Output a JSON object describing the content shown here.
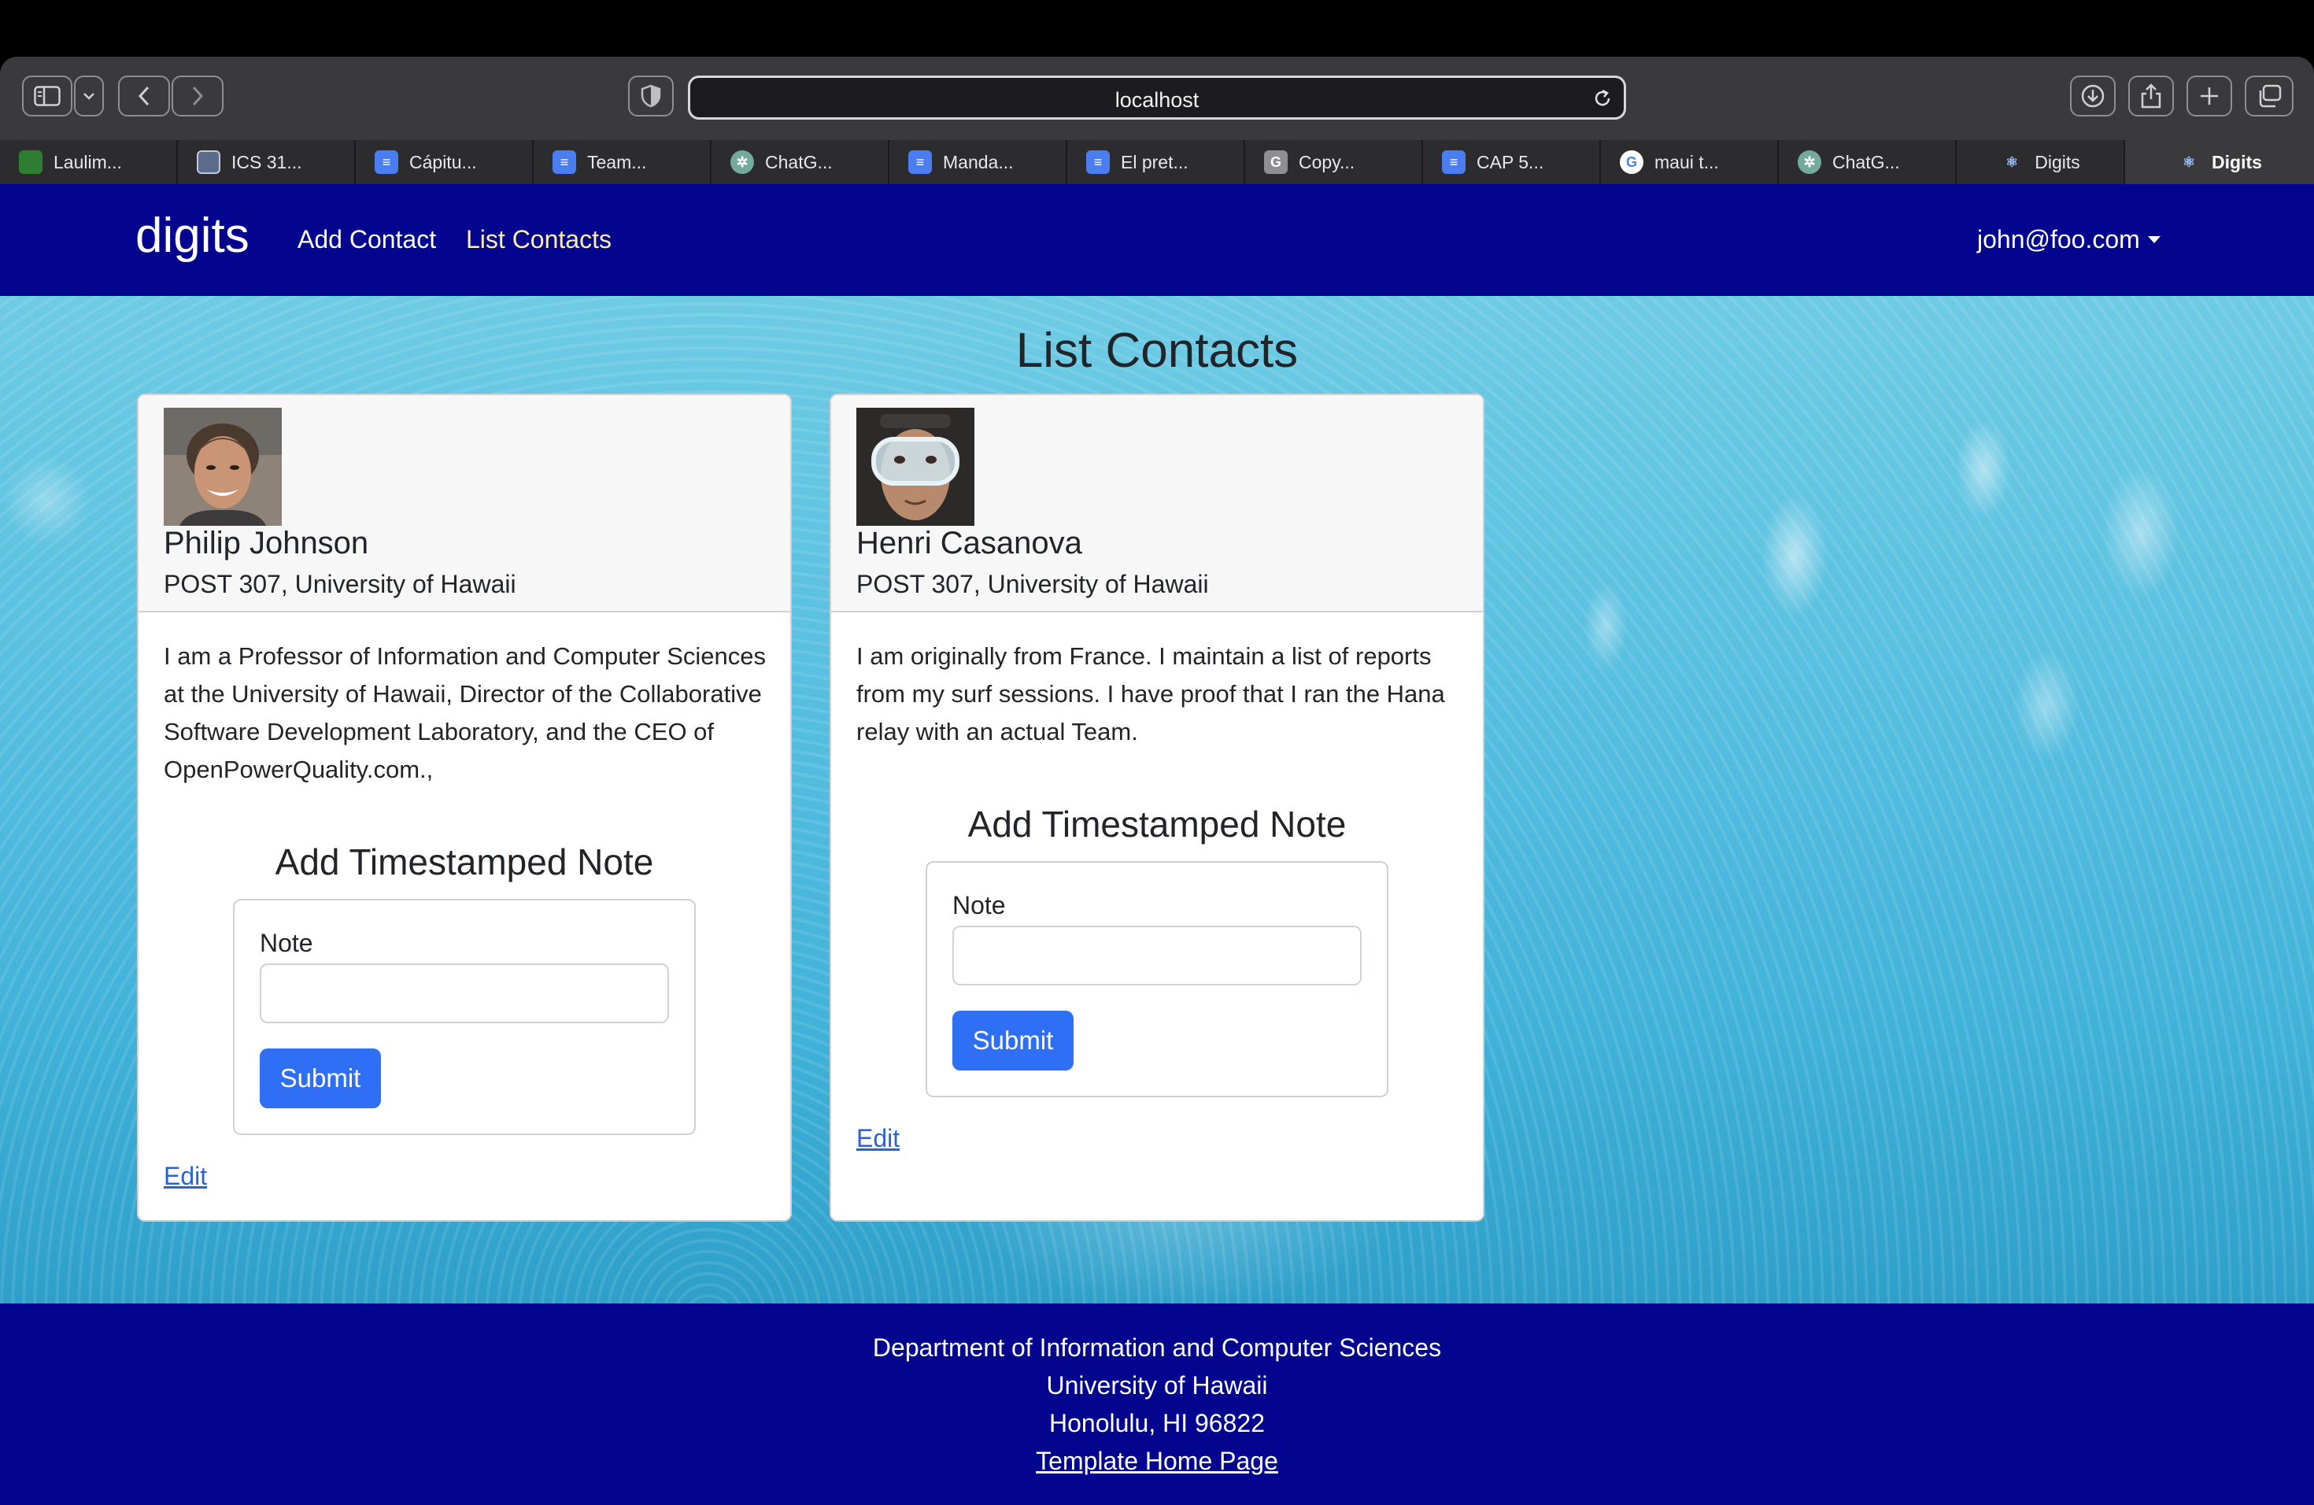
{
  "browser": {
    "url": "localhost",
    "tabs": [
      {
        "label": "Laulim...",
        "favicon": "leaf-icon",
        "color": "#2e7d32"
      },
      {
        "label": "ICS 31...",
        "favicon": "square-icon",
        "color": "#5b6b8c"
      },
      {
        "label": "Cápitu...",
        "favicon": "docs-icon",
        "color": "#4a7df0"
      },
      {
        "label": "Team...",
        "favicon": "docs-icon",
        "color": "#4a7df0"
      },
      {
        "label": "ChatG...",
        "favicon": "chatgpt-icon",
        "color": "#74aa9c"
      },
      {
        "label": "Manda...",
        "favicon": "docs-icon",
        "color": "#4a7df0"
      },
      {
        "label": "El pret...",
        "favicon": "docs-icon",
        "color": "#4a7df0"
      },
      {
        "label": "Copy...",
        "favicon": "g-icon",
        "color": "#8e8e93"
      },
      {
        "label": "CAP 5...",
        "favicon": "docs-icon",
        "color": "#4a7df0"
      },
      {
        "label": "maui t...",
        "favicon": "google-icon",
        "color": "#ffffff"
      },
      {
        "label": "ChatG...",
        "favicon": "chatgpt-icon",
        "color": "#74aa9c"
      },
      {
        "label": "Digits",
        "favicon": "react-icon",
        "color": "#2c2c2e"
      },
      {
        "label": "Digits",
        "favicon": "react-icon",
        "color": "#3a3a3c"
      }
    ]
  },
  "navbar": {
    "brand": "digits",
    "links": [
      "Add Contact",
      "List Contacts"
    ],
    "user": "john@foo.com",
    "bg_color": "#04058e"
  },
  "page": {
    "title": "List Contacts"
  },
  "contacts": [
    {
      "name": "Philip Johnson",
      "address": "POST 307, University of Hawaii",
      "description": "I am a Professor of Information and Computer Sciences at the University of Hawaii, Director of the Collaborative Software Development Laboratory, and the CEO of OpenPowerQuality.com.,",
      "note_title": "Add Timestamped Note",
      "note_label": "Note",
      "note_value": "",
      "submit_label": "Submit",
      "edit_label": "Edit"
    },
    {
      "name": "Henri Casanova",
      "address": "POST 307, University of Hawaii",
      "description": "I am originally from France. I maintain a list of reports from my surf sessions. I have proof that I ran the Hana relay with an actual Team.",
      "note_title": "Add Timestamped Note",
      "note_label": "Note",
      "note_value": "",
      "submit_label": "Submit",
      "edit_label": "Edit"
    }
  ],
  "footer": {
    "line1": "Department of Information and Computer Sciences",
    "line2": "University of Hawaii",
    "line3": "Honolulu, HI 96822",
    "link": "Template Home Page"
  },
  "colors": {
    "primary_button": "#2f6ff5",
    "link": "#2a63d8"
  }
}
